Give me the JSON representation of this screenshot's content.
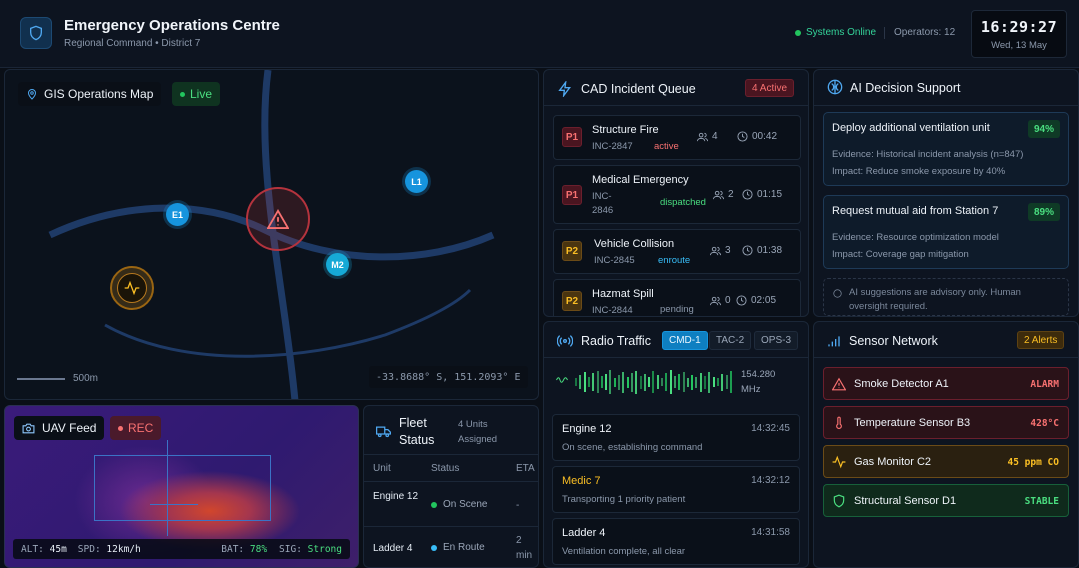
{
  "header": {
    "title": "Emergency Operations Centre",
    "subtitle": "Regional Command • District 7",
    "status": "Systems Online",
    "operators": "Operators: 12",
    "time": "16:29:27",
    "date": "Wed, 13 May"
  },
  "map": {
    "title": "GIS Operations Map",
    "live": "Live",
    "scale": "500m",
    "coords": "-33.8688° S, 151.2093° E",
    "markers": {
      "e1": "E1",
      "l1": "L1",
      "m2": "M2"
    }
  },
  "uav": {
    "title": "UAV Feed",
    "rec": "REC",
    "alt_label": "ALT:",
    "alt": "45m",
    "spd_label": "SPD:",
    "spd": "12km/h",
    "bat_label": "BAT:",
    "bat": "78%",
    "sig_label": "SIG:",
    "sig": "Strong"
  },
  "fleet": {
    "title": "Fleet Status",
    "subtitle": "4 Units Assigned",
    "columns": [
      "Unit",
      "Status",
      "ETA"
    ],
    "rows": [
      {
        "unit": "Engine 12",
        "status": "On Scene",
        "eta": "-",
        "color": "#22c55e"
      },
      {
        "unit": "Ladder 4",
        "status": "En Route",
        "eta": "2 min",
        "color": "#38bdf8"
      }
    ]
  },
  "cad": {
    "title": "CAD Incident Queue",
    "badge": "4 Active",
    "incidents": [
      {
        "priority": "P1",
        "name": "Structure Fire",
        "id": "INC-2847",
        "status": "active",
        "status_color": "#f87171",
        "units": "4",
        "time": "00:42"
      },
      {
        "priority": "P1",
        "name": "Medical Emergency",
        "id": "INC-2846",
        "status": "dispatched",
        "status_color": "#4ade80",
        "units": "2",
        "time": "01:15"
      },
      {
        "priority": "P2",
        "name": "Vehicle Collision",
        "id": "INC-2845",
        "status": "enroute",
        "status_color": "#38bdf8",
        "units": "3",
        "time": "01:38"
      },
      {
        "priority": "P2",
        "name": "Hazmat Spill",
        "id": "INC-2844",
        "status": "pending",
        "status_color": "#8b98ab",
        "units": "0",
        "time": "02:05"
      }
    ]
  },
  "radio": {
    "title": "Radio Traffic",
    "tabs": [
      "CMD-1",
      "TAC-2",
      "OPS-3"
    ],
    "frequency": "154.280 MHz",
    "messages": [
      {
        "from": "Engine 12",
        "time": "14:32:45",
        "text": "On scene, establishing command",
        "color": "#eef3f9"
      },
      {
        "from": "Medic 7",
        "time": "14:32:12",
        "text": "Transporting 1 priority patient",
        "color": "#fbbf24"
      },
      {
        "from": "Ladder 4",
        "time": "14:31:58",
        "text": "Ventilation complete, all clear",
        "color": "#eef3f9"
      }
    ]
  },
  "ai": {
    "title": "AI Decision Support",
    "cards": [
      {
        "title": "Deploy additional ventilation unit",
        "pct": "94%",
        "evidence": "Evidence: Historical incident analysis (n=847)",
        "impact": "Impact: Reduce smoke exposure by 40%"
      },
      {
        "title": "Request mutual aid from Station 7",
        "pct": "89%",
        "evidence": "Evidence: Resource optimization model",
        "impact": "Impact: Coverage gap mitigation"
      }
    ],
    "note": "AI suggestions are advisory only. Human oversight required."
  },
  "sensors": {
    "title": "Sensor Network",
    "badge": "2 Alerts",
    "items": [
      {
        "name": "Smoke Detector A1",
        "value": "ALARM",
        "icon": "alert-triangle-icon",
        "color": "#f87171"
      },
      {
        "name": "Temperature Sensor B3",
        "value": "428°C",
        "icon": "thermometer-icon",
        "color": "#f87171"
      },
      {
        "name": "Gas Monitor C2",
        "value": "45 ppm CO",
        "icon": "activity-icon",
        "color": "#fbbf24"
      },
      {
        "name": "Structural Sensor D1",
        "value": "STABLE",
        "icon": "shield-icon",
        "color": "#4ade80"
      }
    ]
  }
}
